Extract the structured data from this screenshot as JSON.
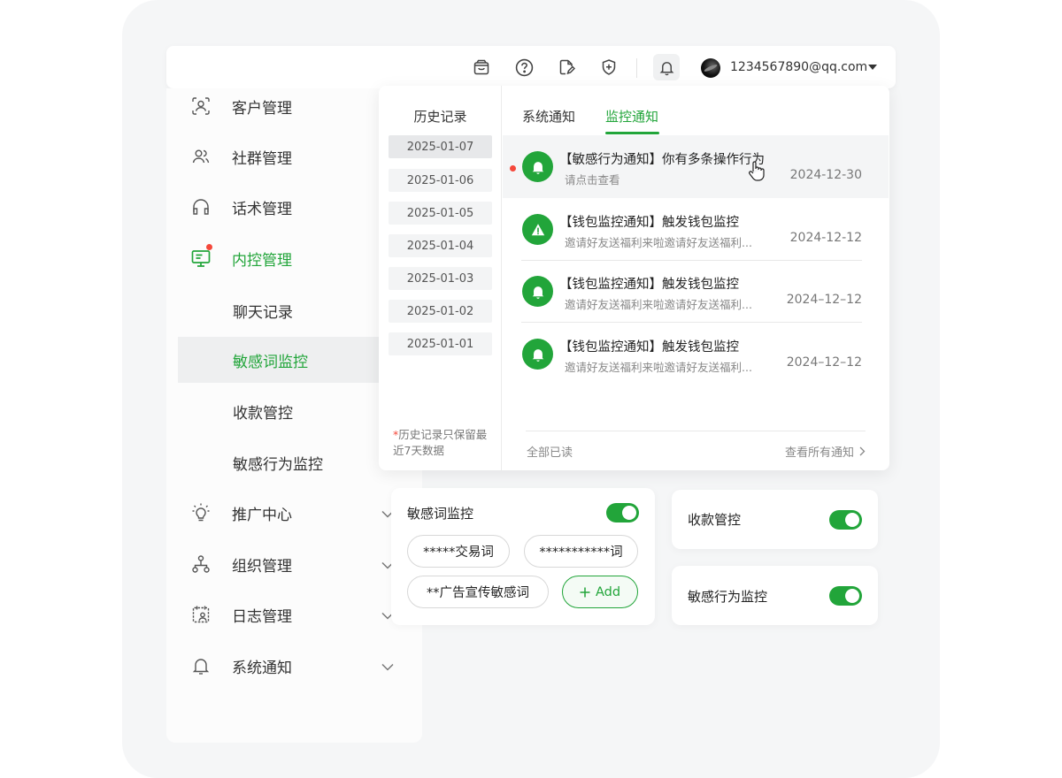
{
  "topbar": {
    "icons": [
      "shopping-bag-icon",
      "help-circle-icon",
      "edit-document-icon",
      "shield-plus-icon",
      "bell-icon"
    ],
    "account_email": "1234567890@qq.com"
  },
  "sidebar": {
    "items": [
      {
        "label": "客户管理",
        "icon": "customer-scan-icon"
      },
      {
        "label": "社群管理",
        "icon": "users-icon"
      },
      {
        "label": "话术管理",
        "icon": "headset-icon"
      },
      {
        "label": "内控管理",
        "icon": "monitor-icon",
        "active": true,
        "badge": true
      }
    ],
    "sub_items": [
      {
        "label": "聊天记录"
      },
      {
        "label": "敏感词监控",
        "active": true
      },
      {
        "label": "收款管控"
      },
      {
        "label": "敏感行为监控"
      }
    ],
    "lower_items": [
      {
        "label": "推广中心",
        "icon": "lightbulb-icon"
      },
      {
        "label": "组织管理",
        "icon": "org-tree-icon"
      },
      {
        "label": "日志管理",
        "icon": "log-user-icon"
      },
      {
        "label": "系统通知",
        "icon": "bell-icon"
      }
    ]
  },
  "popover": {
    "history_title": "历史记录",
    "dates": [
      "2025-01-07",
      "2025-01-06",
      "2025-01-05",
      "2025-01-04",
      "2025-01-03",
      "2025-01-02",
      "2025-01-01"
    ],
    "history_note_star": "*",
    "history_note": "历史记录只保留最近7天数据",
    "tabs": [
      "系统通知",
      "监控通知"
    ],
    "active_tab": "监控通知",
    "notifications": [
      {
        "title": "【敏感行为通知】你有多条操作行为",
        "desc": "请点击查看",
        "date": "2024-12-30",
        "icon": "bell-icon",
        "unread": true
      },
      {
        "title": "【钱包监控通知】触发钱包监控",
        "desc": "邀请好友送福利来啦邀请好友送福利...",
        "date": "2024-12-12",
        "icon": "warning-icon"
      },
      {
        "title": "【钱包监控通知】触发钱包监控",
        "desc": "邀请好友送福利来啦邀请好友送福利...",
        "date": "2024–12–12",
        "icon": "bell-icon"
      },
      {
        "title": "【钱包监控通知】触发钱包监控",
        "desc": "邀请好友送福利来啦邀请好友送福利...",
        "date": "2024–12–12",
        "icon": "bell-icon"
      }
    ],
    "read_all": "全部已读",
    "view_all": "查看所有通知"
  },
  "sensitive_card": {
    "title": "敏感词监控",
    "enabled": true,
    "chips": [
      "*****交易词",
      "***********词",
      "**广告宣传敏感词"
    ],
    "add_label": "Add"
  },
  "payment_card": {
    "title": "收款管控",
    "enabled": true
  },
  "behavior_card": {
    "title": "敏感行为监控",
    "enabled": true
  },
  "colors": {
    "accent": "#22a53a",
    "badge": "#f5483b"
  }
}
